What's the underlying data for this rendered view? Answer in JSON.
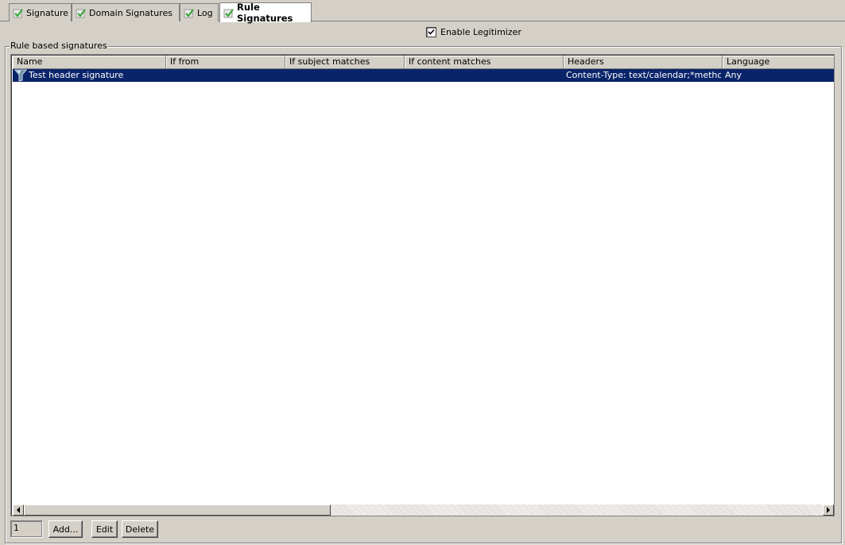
{
  "tabs": [
    {
      "label": "Signature",
      "active": false
    },
    {
      "label": "Domain Signatures",
      "active": false
    },
    {
      "label": "Log",
      "active": false
    },
    {
      "label": "Rule Signatures",
      "active": true
    }
  ],
  "enable_legitimizer": {
    "label": "Enable Legitimizer",
    "checked": true
  },
  "group": {
    "label": "Rule based signatures"
  },
  "list": {
    "columns": [
      "Name",
      "If from",
      "If subject matches",
      "If content matches",
      "Headers",
      "Language"
    ],
    "rows": [
      {
        "icon": "funnel-icon",
        "name": "Test header signature",
        "if_from": "",
        "if_subject": "",
        "if_content": "",
        "headers": "Content-Type: text/calendar;*method...",
        "language": "Any",
        "selected": true
      }
    ]
  },
  "count": "1",
  "buttons": {
    "add": "Add...",
    "edit": "Edit",
    "delete": "Delete"
  },
  "colors": {
    "selection": "#0a246a",
    "face": "#d4d0c8",
    "check_green": "#3aa63a"
  }
}
